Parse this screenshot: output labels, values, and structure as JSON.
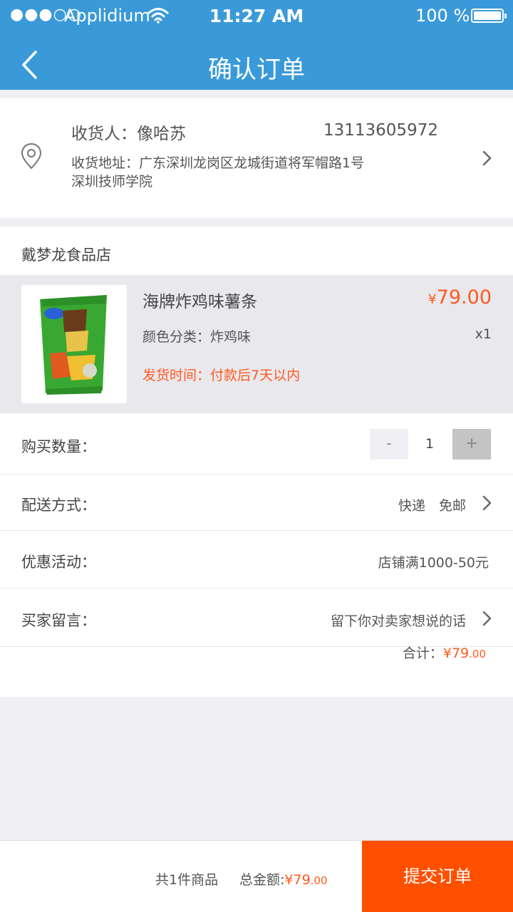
{
  "status_bar": {
    "signal": "●●●○○",
    "carrier": "Applidium",
    "time": "11:27 AM",
    "battery": "100 %"
  },
  "nav": {
    "title": "确认订单",
    "back_icon": "chevron-left-icon"
  },
  "address": {
    "recipient": "收货人：像哈苏",
    "phone": "13113605972",
    "address_line1": "收货地址：广东深圳龙岗区龙城街道将军帽路1号",
    "address_line2": "深圳技师学院"
  },
  "store": {
    "name": "戴梦龙食品店",
    "product": {
      "name": "海牌炸鸡味薯条",
      "currency": "¥",
      "price": "79.00",
      "variant": "颜色分类：炸鸡味",
      "quantity_label": "x1",
      "ship_time": "发货时间：付款后7天以内"
    }
  },
  "rows": {
    "quantity_label": "购买数量：",
    "quantity_minus": "-",
    "quantity_value": "1",
    "quantity_plus": "+",
    "delivery_label": "配送方式：",
    "delivery_value": "快递　免邮",
    "promo_label": "优惠活动：",
    "promo_value": "店铺满1000-50元",
    "message_label": "买家留言：",
    "message_placeholder": "留下你对卖家想说的话",
    "subtotal_label": "合计：",
    "subtotal_main": "¥79",
    "subtotal_cents": ".00"
  },
  "bottom_bar": {
    "count": "共1件商品",
    "total_label": "总金额:",
    "total_main": "¥79",
    "total_cents": ".00",
    "submit": "提交订单"
  },
  "colors": {
    "header": "#3a9ad9",
    "accent": "#ff5000",
    "price": "#ff5a1f"
  }
}
